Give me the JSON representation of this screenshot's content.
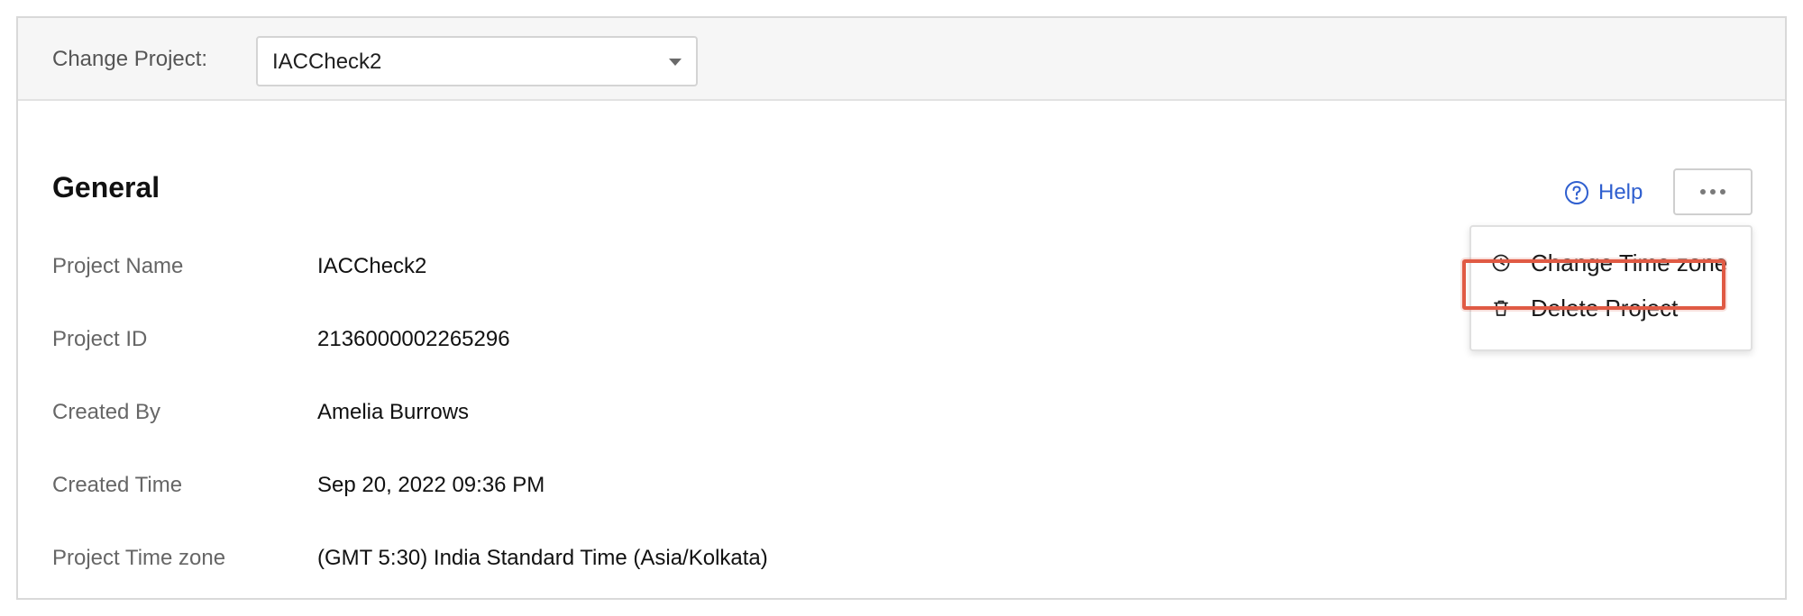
{
  "topbar": {
    "change_project_label": "Change Project:",
    "selected_project": "IACCheck2"
  },
  "section": {
    "title": "General",
    "help_label": "Help"
  },
  "fields": [
    {
      "label": "Project Name",
      "value": "IACCheck2"
    },
    {
      "label": "Project ID",
      "value": "2136000002265296"
    },
    {
      "label": "Created By",
      "value": "Amelia Burrows"
    },
    {
      "label": "Created Time",
      "value": "Sep 20, 2022 09:36 PM"
    },
    {
      "label": "Project Time zone",
      "value": "(GMT 5:30) India Standard Time (Asia/Kolkata)"
    }
  ],
  "menu": {
    "items": [
      {
        "label": "Change Time zone",
        "icon": "clock-icon"
      },
      {
        "label": "Delete Project",
        "icon": "trash-icon",
        "highlighted": true
      }
    ]
  },
  "colors": {
    "link": "#2f5fcf",
    "highlight": "#e05a44",
    "topbar_bg": "#f6f6f6"
  }
}
